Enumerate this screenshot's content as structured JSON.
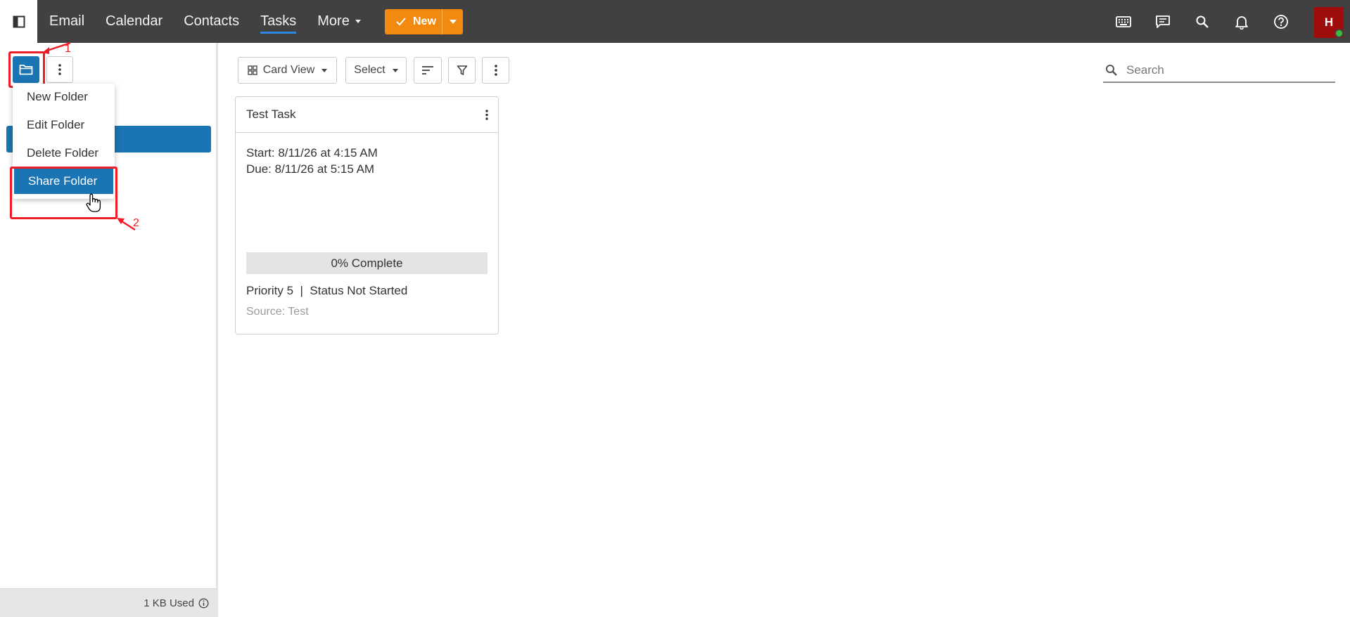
{
  "topbar": {
    "nav": [
      {
        "label": "Email"
      },
      {
        "label": "Calendar"
      },
      {
        "label": "Contacts"
      },
      {
        "label": "Tasks",
        "active": true
      },
      {
        "label": "More"
      }
    ],
    "new_label": "New",
    "avatar_initial": "H",
    "icons": [
      "keyboard-icon",
      "chat-icon",
      "search-icon",
      "bell-icon",
      "help-icon"
    ]
  },
  "sidebar": {
    "menu": {
      "items": [
        {
          "label": "New Folder"
        },
        {
          "label": "Edit Folder"
        },
        {
          "label": "Delete Folder"
        },
        {
          "label": "Share Folder",
          "highlighted": true
        }
      ]
    },
    "storage_label": "1 KB Used",
    "annotations": {
      "step1": "1",
      "step2": "2"
    }
  },
  "toolbar": {
    "view_label": "Card View",
    "select_label": "Select",
    "search_placeholder": "Search"
  },
  "task_card": {
    "title": "Test Task",
    "start": "Start: 8/11/26 at 4:15 AM",
    "due": "Due: 8/11/26 at 5:15 AM",
    "progress_percent": 0,
    "progress_label": "0% Complete",
    "meta": "Priority 5  |  Status Not Started",
    "source": "Source: Test"
  },
  "colors": {
    "accent_blue": "#1b74b3",
    "new_orange": "#f28a0f",
    "topbar": "#414141",
    "avatar": "#a00d0d",
    "annotation_red": "#ee1c24"
  }
}
